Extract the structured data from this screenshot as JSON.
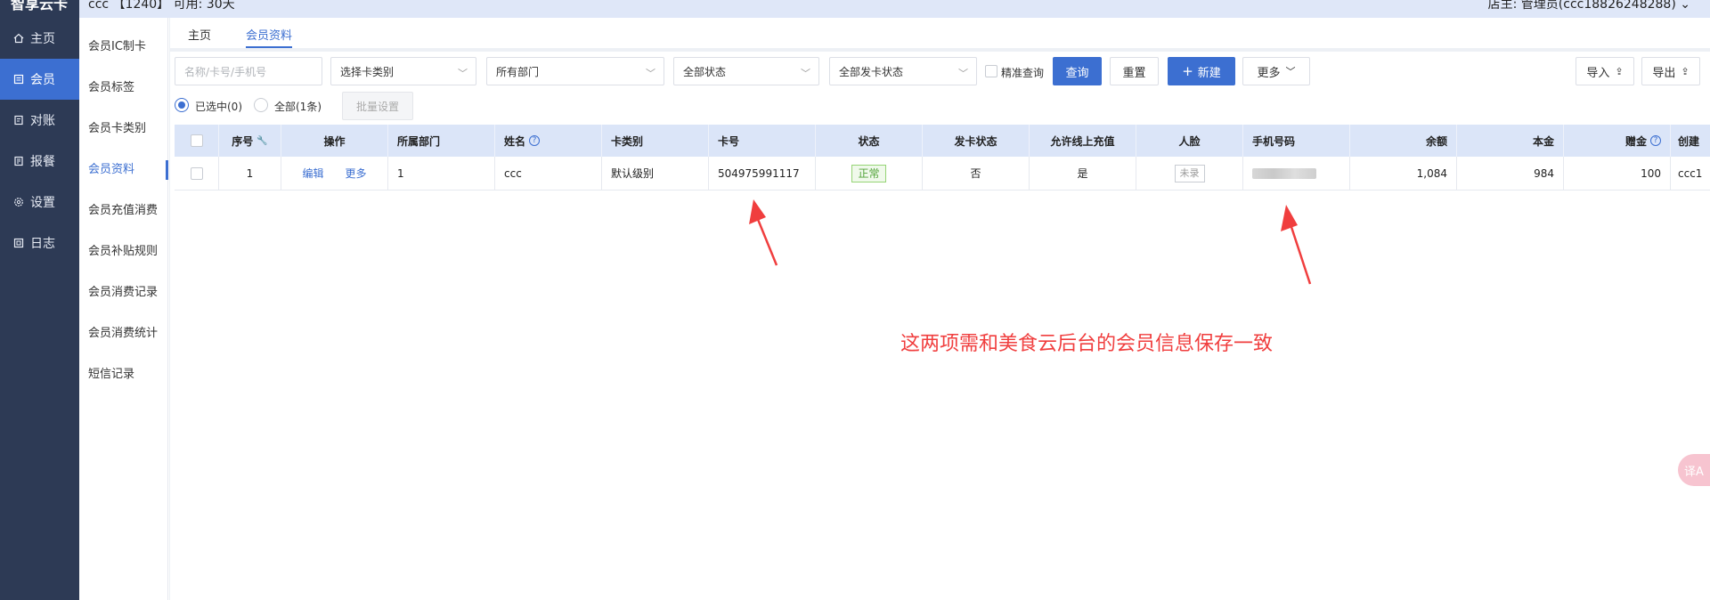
{
  "app": {
    "logo": "智享云卡"
  },
  "topbar": {
    "store_info": "ccc 【1240】 可用: 30天",
    "user_info": "店主: 管理员(ccc18826248288)"
  },
  "nav": {
    "items": [
      {
        "label": "主页",
        "icon": "home-icon"
      },
      {
        "label": "会员",
        "icon": "member-icon"
      },
      {
        "label": "对账",
        "icon": "reconcile-icon"
      },
      {
        "label": "报餐",
        "icon": "meal-icon"
      },
      {
        "label": "设置",
        "icon": "gear-icon"
      },
      {
        "label": "日志",
        "icon": "log-icon"
      }
    ],
    "active_index": 1
  },
  "submenu": {
    "items": [
      "会员IC制卡",
      "会员标签",
      "会员卡类别",
      "会员资料",
      "会员充值消费",
      "会员补贴规则",
      "会员消费记录",
      "会员消费统计",
      "短信记录"
    ],
    "active_index": 3
  },
  "tabs": [
    {
      "label": "主页"
    },
    {
      "label": "会员资料"
    }
  ],
  "filters": {
    "search_placeholder": "名称/卡号/手机号",
    "card_type": "选择卡类别",
    "department": "所有部门",
    "status": "全部状态",
    "issue_status": "全部发卡状态",
    "exact_label": "精准查询",
    "query_label": "查询",
    "reset_label": "重置",
    "new_label": "新建",
    "more_label": "更多",
    "import_label": "导入",
    "export_label": "导出"
  },
  "selection": {
    "selected_label": "已选中(0)",
    "all_label": "全部(1条)",
    "batch_label": "批量设置"
  },
  "table": {
    "headers": [
      "序号",
      "操作",
      "所属部门",
      "姓名",
      "卡类别",
      "卡号",
      "状态",
      "发卡状态",
      "允许线上充值",
      "人脸",
      "手机号码",
      "余额",
      "本金",
      "赠金",
      "创建"
    ],
    "rows": [
      {
        "index": "1",
        "edit": "编辑",
        "more": "更多",
        "dept": "1",
        "name": "ccc",
        "card_type": "默认级别",
        "card_no": "504975991117",
        "status": "正常",
        "issue_status": "否",
        "online_recharge": "是",
        "face": "未录",
        "balance": "1,084",
        "principal": "984",
        "bonus": "100",
        "created": "ccc1"
      }
    ]
  },
  "annotation": {
    "text": "这两项需和美食云后台的会员信息保存一致",
    "color": "#f03e3e"
  },
  "float_button": {
    "label": "译A"
  },
  "colors": {
    "nav_bg": "#2d3a55",
    "accent": "#3c6fd1",
    "header_row": "#dbe5f8"
  }
}
